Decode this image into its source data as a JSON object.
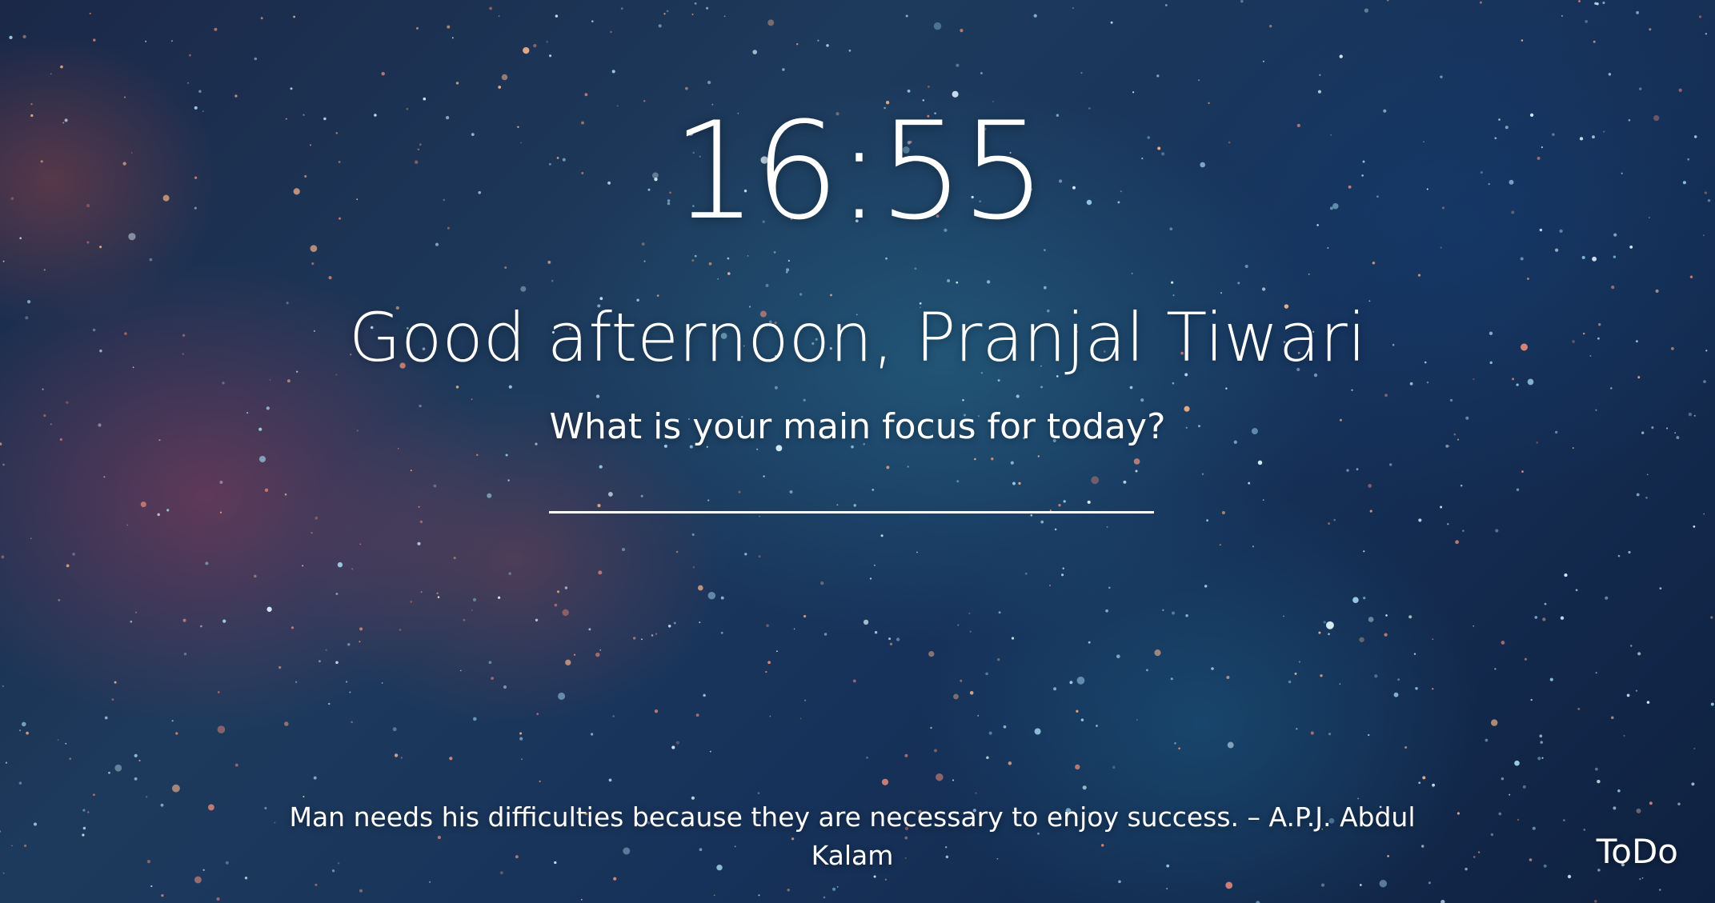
{
  "clock": {
    "time": "16:55"
  },
  "greeting": {
    "text": "Good afternoon, Pranjal Tiwari"
  },
  "focus": {
    "question": "What is your main focus for today?",
    "value": "",
    "placeholder": ""
  },
  "quote": {
    "text": "Man needs his difficulties because they are necessary to enjoy success. – A.P.J. Abdul Kalam"
  },
  "todo": {
    "label": "ToDo"
  },
  "theme": {
    "text_color": "#ffffff",
    "background": "starry-nebula-painting"
  }
}
